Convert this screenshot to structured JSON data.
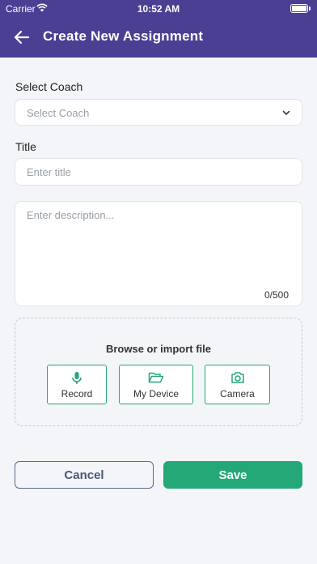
{
  "status_bar": {
    "carrier": "Carrier",
    "time": "10:52 AM"
  },
  "header": {
    "title": "Create New Assignment",
    "back_icon": "arrow-left-icon"
  },
  "form": {
    "coach_label": "Select Coach",
    "coach_placeholder": "Select Coach",
    "title_label": "Title",
    "title_placeholder": "Enter title",
    "description_placeholder": "Enter description...",
    "description_counter": "0/500"
  },
  "upload": {
    "title": "Browse or import file",
    "options": [
      {
        "label": "Record",
        "icon": "microphone-icon"
      },
      {
        "label": "My Device",
        "icon": "folder-open-icon"
      },
      {
        "label": "Camera",
        "icon": "camera-icon"
      }
    ]
  },
  "actions": {
    "cancel_label": "Cancel",
    "save_label": "Save"
  },
  "colors": {
    "header": "#4a3f93",
    "accent": "#25a877",
    "background": "#f4f5f9"
  }
}
